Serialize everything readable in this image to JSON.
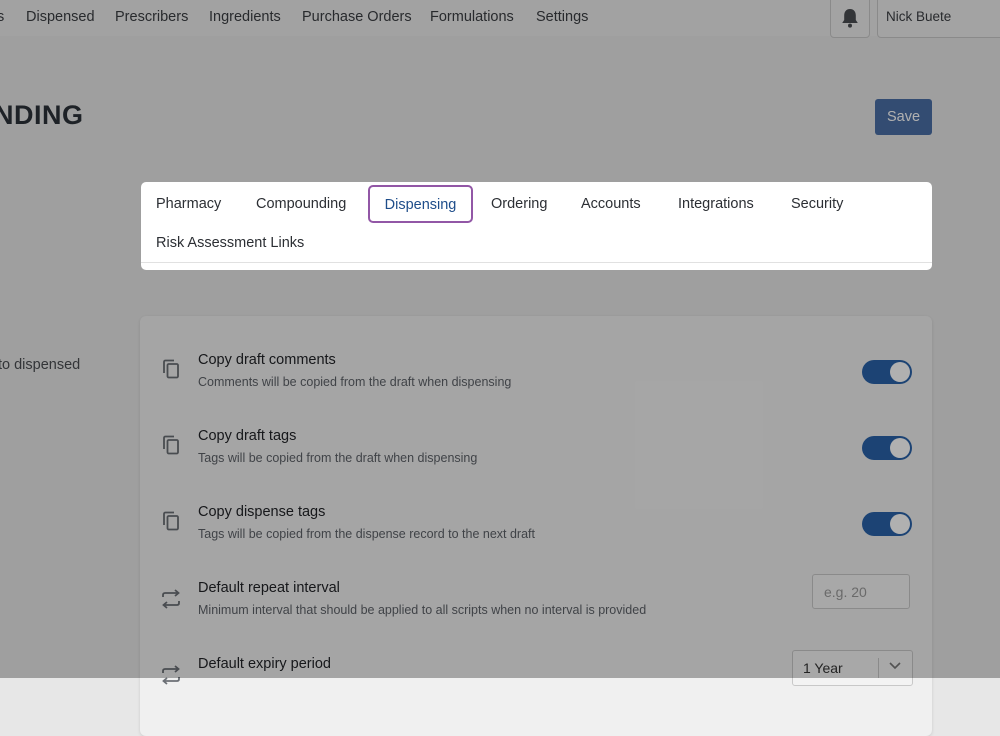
{
  "topnav": {
    "items": [
      "s",
      "Dispensed",
      "Prescribers",
      "Ingredients",
      "Purchase Orders",
      "Formulations",
      "Settings"
    ],
    "user_name": "Nick Buete",
    "bell_icon": "bell-icon"
  },
  "page": {
    "title": "NDING",
    "save_label": "Save",
    "side_label": "to dispensed"
  },
  "tabs": [
    "Pharmacy",
    "Compounding",
    "Dispensing",
    "Ordering",
    "Accounts",
    "Integrations",
    "Security",
    "Risk Assessment Links"
  ],
  "active_tab": "Dispensing",
  "settings": [
    {
      "icon": "copy-icon",
      "title": "Copy draft comments",
      "description": "Comments will be copied from the draft when dispensing",
      "control": "toggle",
      "on": true
    },
    {
      "icon": "copy-icon",
      "title": "Copy draft tags",
      "description": "Tags will be copied from the draft when dispensing",
      "control": "toggle",
      "on": true
    },
    {
      "icon": "copy-icon",
      "title": "Copy dispense tags",
      "description": "Tags will be copied from the dispense record to the next draft",
      "control": "toggle",
      "on": true
    },
    {
      "icon": "repeat-icon",
      "title": "Default repeat interval",
      "description": "Minimum interval that should be applied to all scripts when no interval is provided",
      "control": "input",
      "placeholder": "e.g. 20"
    },
    {
      "icon": "repeat-icon",
      "title": "Default expiry period",
      "description": "",
      "control": "select",
      "value": "1 Year"
    }
  ],
  "colors": {
    "primary": "#2962a8",
    "save_button": "#4b6fa5",
    "active_tab_outline": "#9257a6",
    "active_tab_text": "#1e4d8a"
  }
}
